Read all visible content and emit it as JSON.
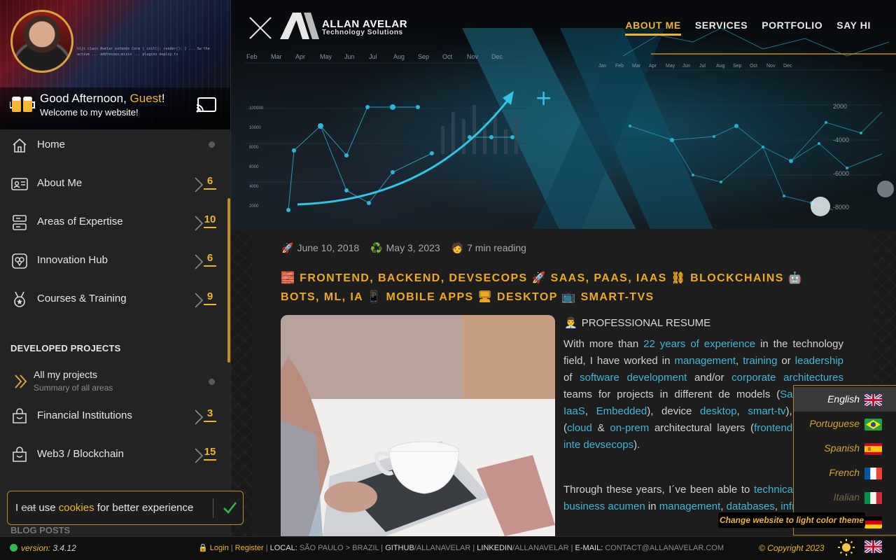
{
  "sidebar": {
    "greeting_prefix": "Good Afternoon, ",
    "greeting_name": "Guest",
    "greeting_suffix": "!",
    "welcome": "Welcome to my website!",
    "nav": [
      {
        "label": "Home",
        "icon": "home-icon",
        "count": null
      },
      {
        "label": "About Me",
        "icon": "id-card-icon",
        "count": "6"
      },
      {
        "label": "Areas of Expertise",
        "icon": "server-icon",
        "count": "10"
      },
      {
        "label": "Innovation Hub",
        "icon": "innovation-icon",
        "count": "6"
      },
      {
        "label": "Courses & Training",
        "icon": "medal-icon",
        "count": "9"
      }
    ],
    "developed_projects_title": "DEVELOPED PROJECTS",
    "all_projects": {
      "label": "All my projects",
      "sub": "Summary of all areas"
    },
    "projects": [
      {
        "label": "Financial Institutions",
        "icon": "bag-icon",
        "count": "3"
      },
      {
        "label": "Web3 / Blockchain",
        "icon": "bag-icon",
        "count": "15"
      }
    ],
    "blog_posts_title": "BLOG POSTS"
  },
  "header": {
    "logo_name": "ALLAN AVELAR",
    "logo_tagline": "Technology Solutions",
    "nav": [
      {
        "label": "ABOUT ME",
        "active": true
      },
      {
        "label": "SERVICES",
        "active": false
      },
      {
        "label": "PORTFOLIO",
        "active": false
      },
      {
        "label": "SAY HI",
        "active": false
      }
    ],
    "hero_months_left": [
      "Feb",
      "Mar",
      "Apr",
      "May",
      "Jun",
      "Jul",
      "Aug",
      "Sep",
      "Oct",
      "Nov",
      "Dec"
    ],
    "hero_months_right": [
      "Jan",
      "Feb",
      "Mar",
      "Apr",
      "May",
      "Jun",
      "Jul",
      "Aug",
      "Sep",
      "Oct",
      "Nov",
      "Dec"
    ],
    "hero_y_left": [
      "100000",
      "10000",
      "8000",
      "6000",
      "4000",
      "2000"
    ],
    "hero_y_right": [
      "2000",
      "-4000",
      "-6000",
      "-8000"
    ]
  },
  "article": {
    "published": "June 10, 2018",
    "updated": "May 3, 2023",
    "reading": "7 min reading",
    "tags_line1": "🧱 FRONTEND, BACKEND, DEVSECOPS 🚀 SAAS, PAAS, IAAS ⛓ BLOCKCHAINS 🤖",
    "tags_line2": "BOTS, ML, IA 📱 MOBILE APPS 🖥 DESKTOP 📺 SMART-TVS",
    "resume_title": "PROFESSIONAL RESUME",
    "p1": [
      {
        "t": "With more than ",
        "h": false
      },
      {
        "t": "22 years of experience",
        "h": true
      },
      {
        "t": " in the technology field, I have worked in ",
        "h": false
      },
      {
        "t": "management",
        "h": true
      },
      {
        "t": ", ",
        "h": false
      },
      {
        "t": "training",
        "h": true
      },
      {
        "t": " or ",
        "h": false
      },
      {
        "t": "leadership",
        "h": true
      },
      {
        "t": " of ",
        "h": false
      },
      {
        "t": "software development",
        "h": true
      },
      {
        "t": " and/or ",
        "h": false
      },
      {
        "t": "corporate architectures",
        "h": true
      },
      {
        "t": " teams for projects in different de",
        "h": false
      },
      {
        "t": " models (",
        "h": false
      },
      {
        "t": "SaaS",
        "h": true
      },
      {
        "t": ", ",
        "h": false
      },
      {
        "t": "PaaS",
        "h": true
      },
      {
        "t": ", ",
        "h": false
      },
      {
        "t": "IaaS",
        "h": true
      },
      {
        "t": ", ",
        "h": false
      },
      {
        "t": "Embedded",
        "h": true
      },
      {
        "t": "), device",
        "h": false
      },
      {
        "t": " ",
        "h": false
      },
      {
        "t": "desktop",
        "h": true
      },
      {
        "t": ", ",
        "h": false
      },
      {
        "t": "smart-tv",
        "h": true
      },
      {
        "t": "), platforms (",
        "h": false
      },
      {
        "t": "cloud",
        "h": true
      },
      {
        "t": " & ",
        "h": false
      },
      {
        "t": "on-prem",
        "h": true
      },
      {
        "t": " architectural layers (",
        "h": false
      },
      {
        "t": "frontend",
        "h": true
      },
      {
        "t": ", ",
        "h": false
      },
      {
        "t": "backend",
        "h": true
      },
      {
        "t": ", ",
        "h": false
      },
      {
        "t": "inte",
        "h": true
      },
      {
        "t": " ",
        "h": false
      },
      {
        "t": "devsecops",
        "h": true
      },
      {
        "t": ").",
        "h": false
      }
    ],
    "p2": [
      {
        "t": "Through these years, I´ve been able to ",
        "h": false
      },
      {
        "t": "technical skills",
        "h": true
      },
      {
        "t": " and ",
        "h": false
      },
      {
        "t": "business acumen",
        "h": true
      },
      {
        "t": " in ",
        "h": false
      },
      {
        "t": "management",
        "h": true
      },
      {
        "t": ", ",
        "h": false
      },
      {
        "t": "databases",
        "h": true
      },
      {
        "t": ", ",
        "h": false
      },
      {
        "t": "infra",
        "h": true
      }
    ]
  },
  "languages": [
    {
      "name": "English",
      "flag": "uk",
      "state": "active"
    },
    {
      "name": "Portuguese",
      "flag": "br",
      "state": "normal"
    },
    {
      "name": "Spanish",
      "flag": "es",
      "state": "normal"
    },
    {
      "name": "French",
      "flag": "fr",
      "state": "normal"
    },
    {
      "name": "Italian",
      "flag": "it",
      "state": "dim"
    },
    {
      "name": "German",
      "flag": "de",
      "state": "dim"
    }
  ],
  "tooltip": "Change website to light color theme",
  "cookie": {
    "i": "I ",
    "eat": "eat",
    "use": " use ",
    "cookies": "cookies",
    "rest": " for better experience"
  },
  "footer": {
    "version_label": "version:",
    "version": "3.4.12",
    "login": "Login",
    "register": "Register",
    "local_label": "LOCAL:",
    "local_value": "SÃO PAULO > BRAZIL",
    "github_label": "GITHUB",
    "github_value": "/ALLANAVELAR",
    "linkedin_label": "LINKEDIN",
    "linkedin_value": "/ALLANAVELAR",
    "email_label": "E-MAIL:",
    "email_value": "CONTACT@ALLANAVELAR.COM",
    "copyright": "© Copyright 2023"
  },
  "colors": {
    "accent": "#f0b429",
    "link": "#3fb5d8",
    "background": "#141414"
  }
}
